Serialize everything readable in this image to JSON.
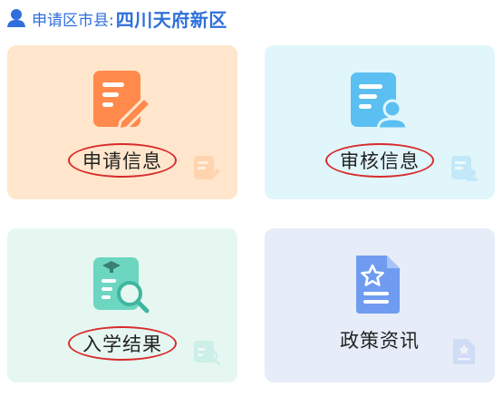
{
  "header": {
    "label": "申请区市县:",
    "value": "四川天府新区",
    "icon": "user-icon"
  },
  "cards": [
    {
      "title": "申请信息",
      "icon": "apply-form-icon",
      "annotated": true
    },
    {
      "title": "审核信息",
      "icon": "review-document-icon",
      "annotated": true
    },
    {
      "title": "入学结果",
      "icon": "search-result-icon",
      "annotated": true
    },
    {
      "title": "政策资讯",
      "icon": "policy-star-document-icon",
      "annotated": false
    }
  ],
  "colors": {
    "accent": "#2f6fdc",
    "annotation": "#d92b2b",
    "card_apply_bg": "#ffe6cc",
    "card_review_bg": "#e0f6fb",
    "card_result_bg": "#e6f7f2",
    "card_policy_bg": "#e6ecf8"
  }
}
